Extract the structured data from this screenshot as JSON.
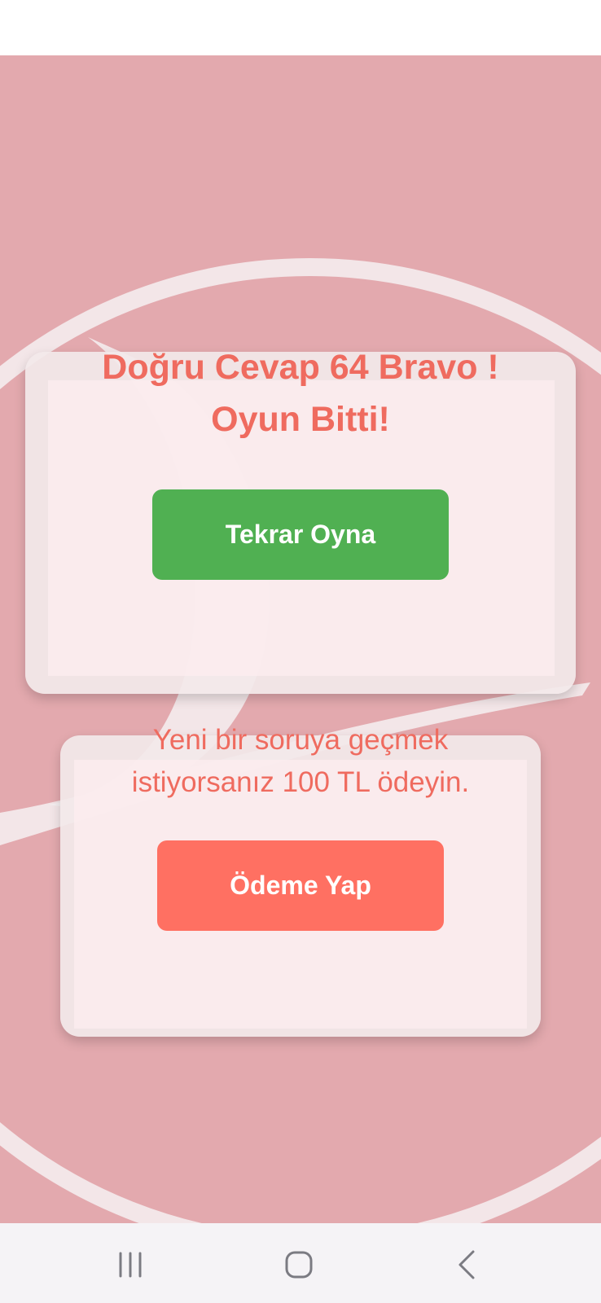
{
  "result": {
    "line1": "Doğru Cevap 64 Bravo !",
    "line2": "Oyun Bitti!"
  },
  "play_again_label": "Tekrar Oyna",
  "payment_prompt": {
    "line1": "Yeni bir soruya geçmek",
    "line2": "istiyorsanız 100 TL ödeyin."
  },
  "payment_button_label": "Ödeme Yap",
  "colors": {
    "background": "#e3a9ae",
    "accent_text": "#ef6b5f",
    "play_again_button": "#50b052",
    "payment_button": "#ff7062"
  },
  "icons": {
    "nav_recent": "recent-apps-icon",
    "nav_home": "home-icon",
    "nav_back": "back-icon",
    "background": "airline-logo-watermark"
  }
}
